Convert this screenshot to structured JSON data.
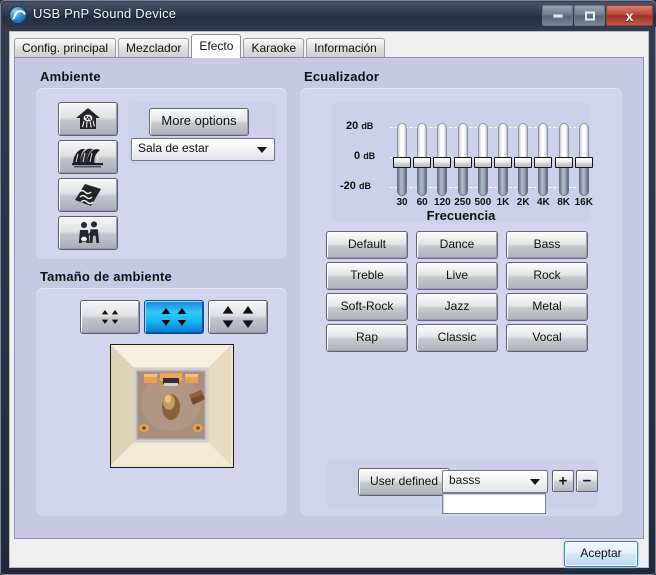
{
  "window": {
    "title": "USB PnP Sound Device",
    "icon": "sound-swirl-icon",
    "minimize_label": "",
    "maximize_label": "",
    "close_label": "x"
  },
  "tabs": [
    {
      "label": "Config. principal",
      "active": false
    },
    {
      "label": "Mezclador",
      "active": false
    },
    {
      "label": "Efecto",
      "active": true
    },
    {
      "label": "Karaoke",
      "active": false
    },
    {
      "label": "Información",
      "active": false
    }
  ],
  "ambience": {
    "group_title": "Ambiente",
    "icon_buttons": [
      {
        "name": "ambience-room-button",
        "icon": "house-icon"
      },
      {
        "name": "ambience-hall-button",
        "icon": "concert-hall-icon"
      },
      {
        "name": "ambience-pad-button",
        "icon": "wave-tile-icon"
      },
      {
        "name": "ambience-live-button",
        "icon": "performers-icon"
      }
    ],
    "more_options_label": "More options",
    "preset_combo": {
      "value": "Sala de estar",
      "options": [
        "Sala de estar"
      ]
    }
  },
  "room_size": {
    "group_title": "Tamaño de ambiente",
    "buttons": [
      {
        "name": "room-size-small-button",
        "selected": false,
        "arrow_spread": "small"
      },
      {
        "name": "room-size-medium-button",
        "selected": true,
        "arrow_spread": "medium"
      },
      {
        "name": "room-size-large-button",
        "selected": false,
        "arrow_spread": "large"
      }
    ],
    "preview_name": "room-preview-image"
  },
  "equalizer": {
    "group_title": "Ecualizador",
    "presets": [
      "Default",
      "Dance",
      "Bass",
      "Treble",
      "Live",
      "Rock",
      "Soft-Rock",
      "Jazz",
      "Metal",
      "Rap",
      "Classic",
      "Vocal"
    ],
    "user_defined_label": "User defined",
    "user_combo": {
      "value": "basss",
      "options": [
        "basss"
      ]
    },
    "add_label": "+",
    "remove_label": "−",
    "name_field": {
      "value": "",
      "placeholder": ""
    }
  },
  "chart_data": {
    "type": "bar",
    "title": "Ecualizador",
    "xlabel": "Frecuencia",
    "ylabel": "dB",
    "categories": [
      "30",
      "60",
      "120",
      "250",
      "500",
      "1K",
      "2K",
      "4K",
      "8K",
      "16K"
    ],
    "values": [
      0,
      0,
      0,
      0,
      0,
      0,
      0,
      0,
      0,
      0
    ],
    "ylim": [
      -20,
      20
    ],
    "ytick_labels": [
      "20 dB",
      "0 dB",
      "-20 dB"
    ],
    "yticks": [
      20,
      0,
      -20
    ],
    "grid": true,
    "legend": "none"
  },
  "footer": {
    "accept_label": "Aceptar"
  },
  "colors": {
    "page_background": "#c6c9e4",
    "panel": "#d3d5ec",
    "subpanel": "#cdd0e9",
    "selected_blue": "#12b7f0",
    "close_red": "#b9453a",
    "accept_border": "#3c7fb1"
  }
}
